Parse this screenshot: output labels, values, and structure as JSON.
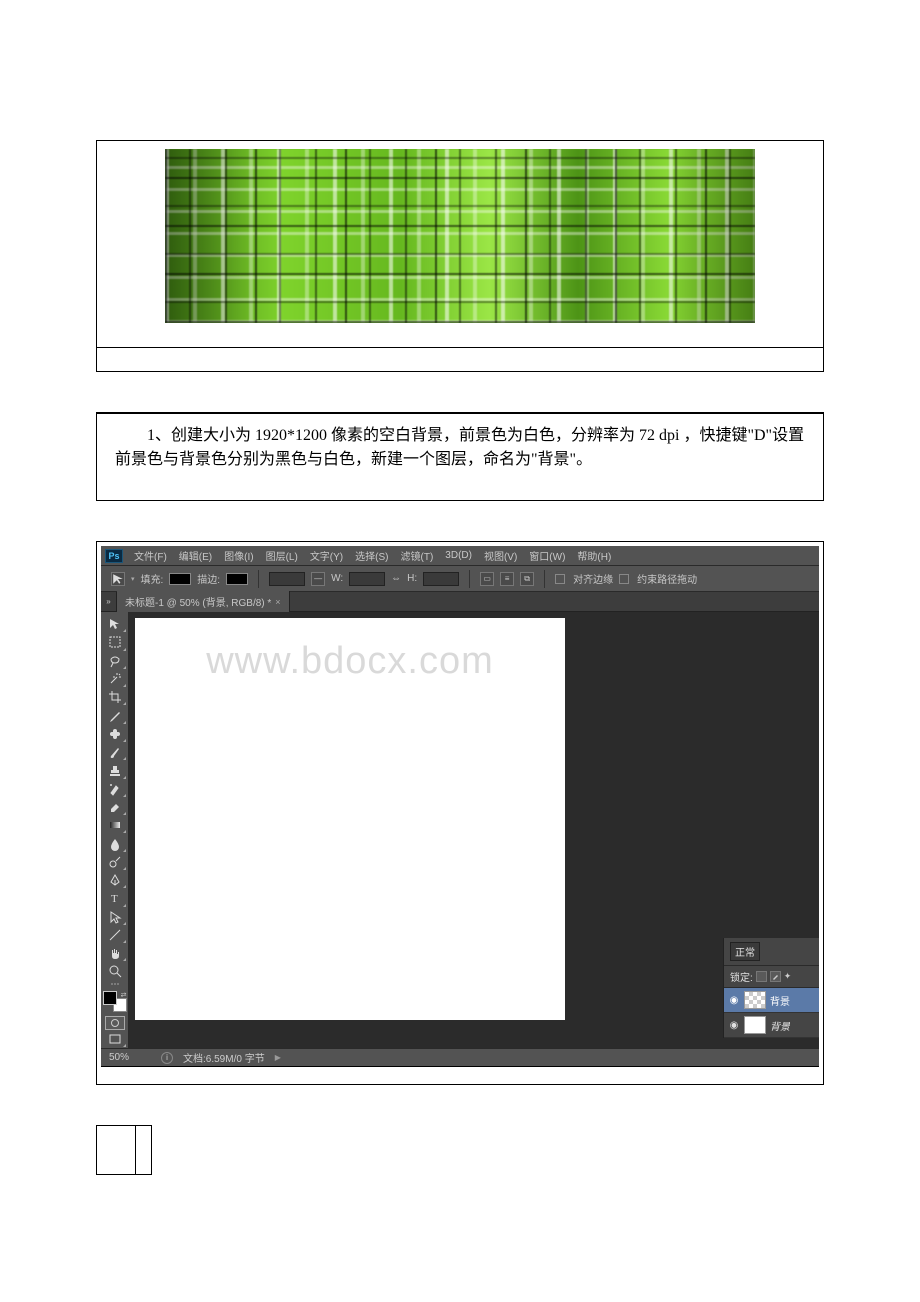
{
  "instruction": {
    "text": "1、创建大小为 1920*1200 像素的空白背景，前景色为白色，分辨率为 72 dpi ，快捷键\"D\"设置前景色与背景色分别为黑色与白色，新建一个图层，命名为\"背景\"。"
  },
  "watermark": "www.bdocx.com",
  "photoshop": {
    "logo": "Ps",
    "menu": [
      "文件(F)",
      "编辑(E)",
      "图像(I)",
      "图层(L)",
      "文字(Y)",
      "选择(S)",
      "滤镜(T)",
      "3D(D)",
      "视图(V)",
      "窗口(W)",
      "帮助(H)"
    ],
    "options": {
      "fill_label": "填充:",
      "stroke_label": "描边:",
      "w_label": "W:",
      "h_label": "H:",
      "link_glyph": "⇔",
      "align_edges": "对齐边缘",
      "constrain_path": "约束路径拖动"
    },
    "tab": {
      "title": "未标题-1 @ 50% (背景, RGB/8) *",
      "close": "×"
    },
    "layers": {
      "blend_mode": "正常",
      "lock_label": "锁定:",
      "items": [
        {
          "name": "背景",
          "thumb": "checker"
        },
        {
          "name": "背景",
          "thumb": "white"
        }
      ]
    },
    "status": {
      "zoom": "50%",
      "doc": "文档:6.59M/0 字节"
    },
    "tools": [
      "move",
      "marquee",
      "lasso",
      "wand",
      "crop",
      "eyedropper",
      "healing",
      "brush",
      "stamp",
      "history",
      "eraser",
      "gradient",
      "blur",
      "dodge",
      "pen",
      "type",
      "path-select",
      "line",
      "hand",
      "zoom"
    ]
  }
}
